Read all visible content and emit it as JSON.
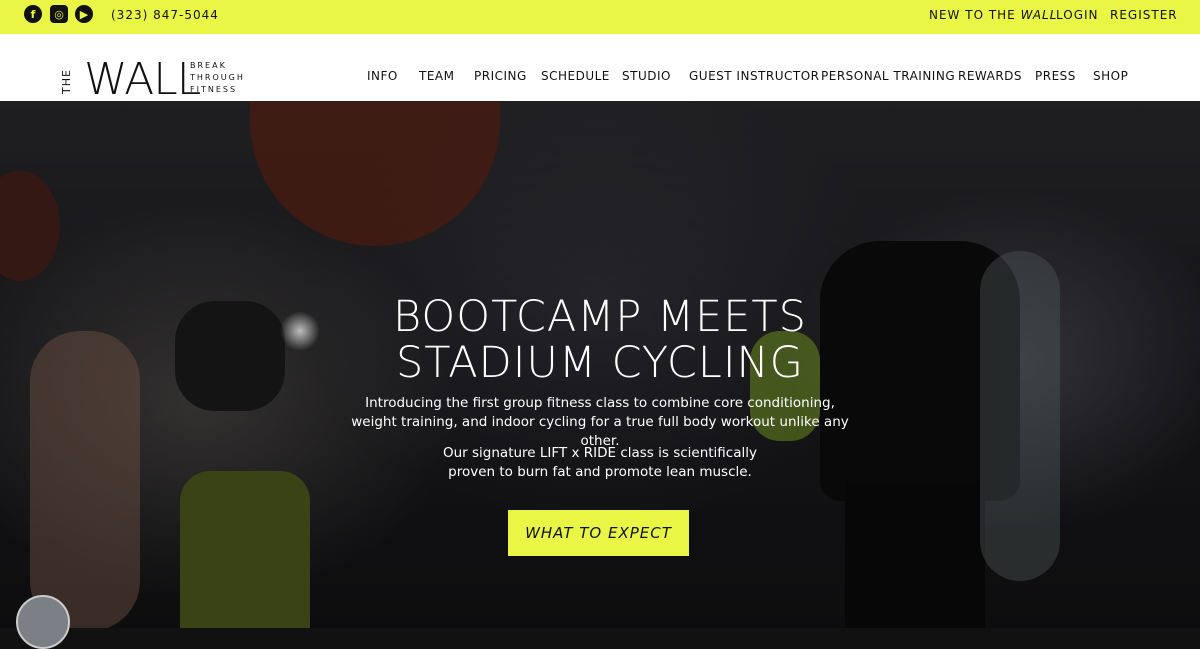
{
  "topbar": {
    "social": [
      {
        "icon": "facebook-icon",
        "glyph": "f"
      },
      {
        "icon": "instagram-icon",
        "glyph": "◎"
      },
      {
        "icon": "youtube-icon",
        "glyph": "▶"
      }
    ],
    "phone": "(323) 847-5044",
    "links": [
      {
        "pre": "NEW TO THE ",
        "em": "WALL"
      },
      {
        "label": "LOGIN"
      },
      {
        "label": "REGISTER"
      }
    ]
  },
  "logo": {
    "the": "THE",
    "wall": "WALL",
    "tag1": "BREAK",
    "tag2": "THROUGH",
    "tag3": "FITNESS"
  },
  "nav": [
    "INFO",
    "TEAM",
    "PRICING",
    "SCHEDULE",
    "STUDIO",
    "GUEST INSTRUCTOR",
    "PERSONAL TRAINING",
    "REWARDS",
    "PRESS",
    "SHOP"
  ],
  "hero": {
    "title_line1": "BOOTCAMP MEETS",
    "title_line2": "STADIUM CYCLING",
    "intro_line1": "Introducing the first group fitness class to combine core conditioning,",
    "intro_line2": "weight training, and indoor cycling for a true full body workout unlike any other.",
    "sig_line1": "Our signature LIFT x RIDE class is scientifically",
    "sig_line2": "proven to burn fat and promote lean muscle.",
    "cta": "WHAT TO EXPECT"
  },
  "colors": {
    "accent": "#eaf646",
    "dark": "#111111"
  }
}
